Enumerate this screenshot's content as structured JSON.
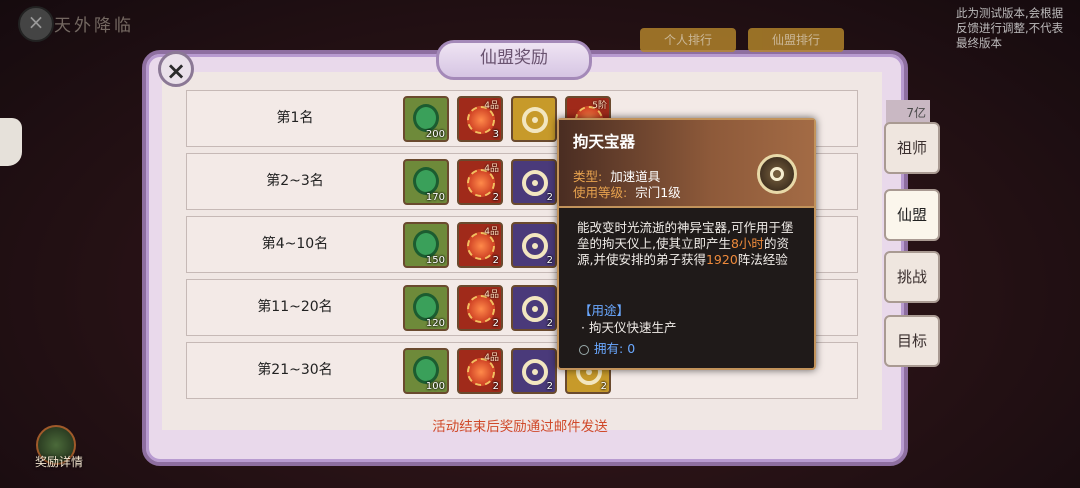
{
  "top": {
    "title": "天外降临"
  },
  "version_note": "此为测试版本,会根据反馈进行调整,不代表最终版本",
  "panel": {
    "title": "仙盟奖励",
    "close_icon": "×",
    "tabs": [
      "个人排行",
      "仙盟排行"
    ],
    "footer_note": "活动结束后奖励通过邮件发送"
  },
  "ranks": [
    {
      "label": "第1名",
      "items": [
        {
          "type": "green",
          "count": "200"
        },
        {
          "type": "red",
          "grade": "4品",
          "count": "3"
        },
        {
          "type": "gold",
          "count": ""
        },
        {
          "type": "red",
          "grade": "5阶",
          "count": ""
        }
      ]
    },
    {
      "label": "第2~3名",
      "items": [
        {
          "type": "green",
          "count": "170"
        },
        {
          "type": "red",
          "grade": "4品",
          "count": "2"
        },
        {
          "type": "purple",
          "count": "2"
        }
      ]
    },
    {
      "label": "第4~10名",
      "items": [
        {
          "type": "green",
          "count": "150"
        },
        {
          "type": "red",
          "grade": "4品",
          "count": "2"
        },
        {
          "type": "purple",
          "count": "2"
        }
      ]
    },
    {
      "label": "第11~20名",
      "items": [
        {
          "type": "green",
          "count": "120"
        },
        {
          "type": "red",
          "grade": "4品",
          "count": "2"
        },
        {
          "type": "purple",
          "count": "2"
        }
      ]
    },
    {
      "label": "第21~30名",
      "items": [
        {
          "type": "green",
          "count": "100"
        },
        {
          "type": "red",
          "grade": "4品",
          "count": "2"
        },
        {
          "type": "purple",
          "count": "2"
        },
        {
          "type": "gold",
          "count": "2"
        }
      ]
    }
  ],
  "right_tabs": [
    "祖师",
    "仙盟",
    "挑战",
    "目标"
  ],
  "right_tab_active": "仙盟",
  "right_top_label": "7亿",
  "reward_detail_label": "奖励详情",
  "tooltip": {
    "name": "拘天宝器",
    "type_key": "类型:",
    "type_val": "加速道具",
    "level_key": "使用等级:",
    "level_val": "宗门1级",
    "desc_1": "能改变时光流逝的神异宝器,可作用于堡垒的拘天仪上,使其立即产生",
    "desc_hl1": "8小时",
    "desc_2": "的资源,并使安排的弟子获得",
    "desc_hl2": "1920",
    "desc_3": "阵法经验",
    "usage_header": "【用途】",
    "usage_item": "· 拘天仪快速生产",
    "own_label": "拥有:",
    "own_value": "0"
  },
  "colors": {
    "highlight": "#ee8a3c",
    "usage_blue": "#6aa8ff",
    "note_red": "#d04a2a"
  }
}
